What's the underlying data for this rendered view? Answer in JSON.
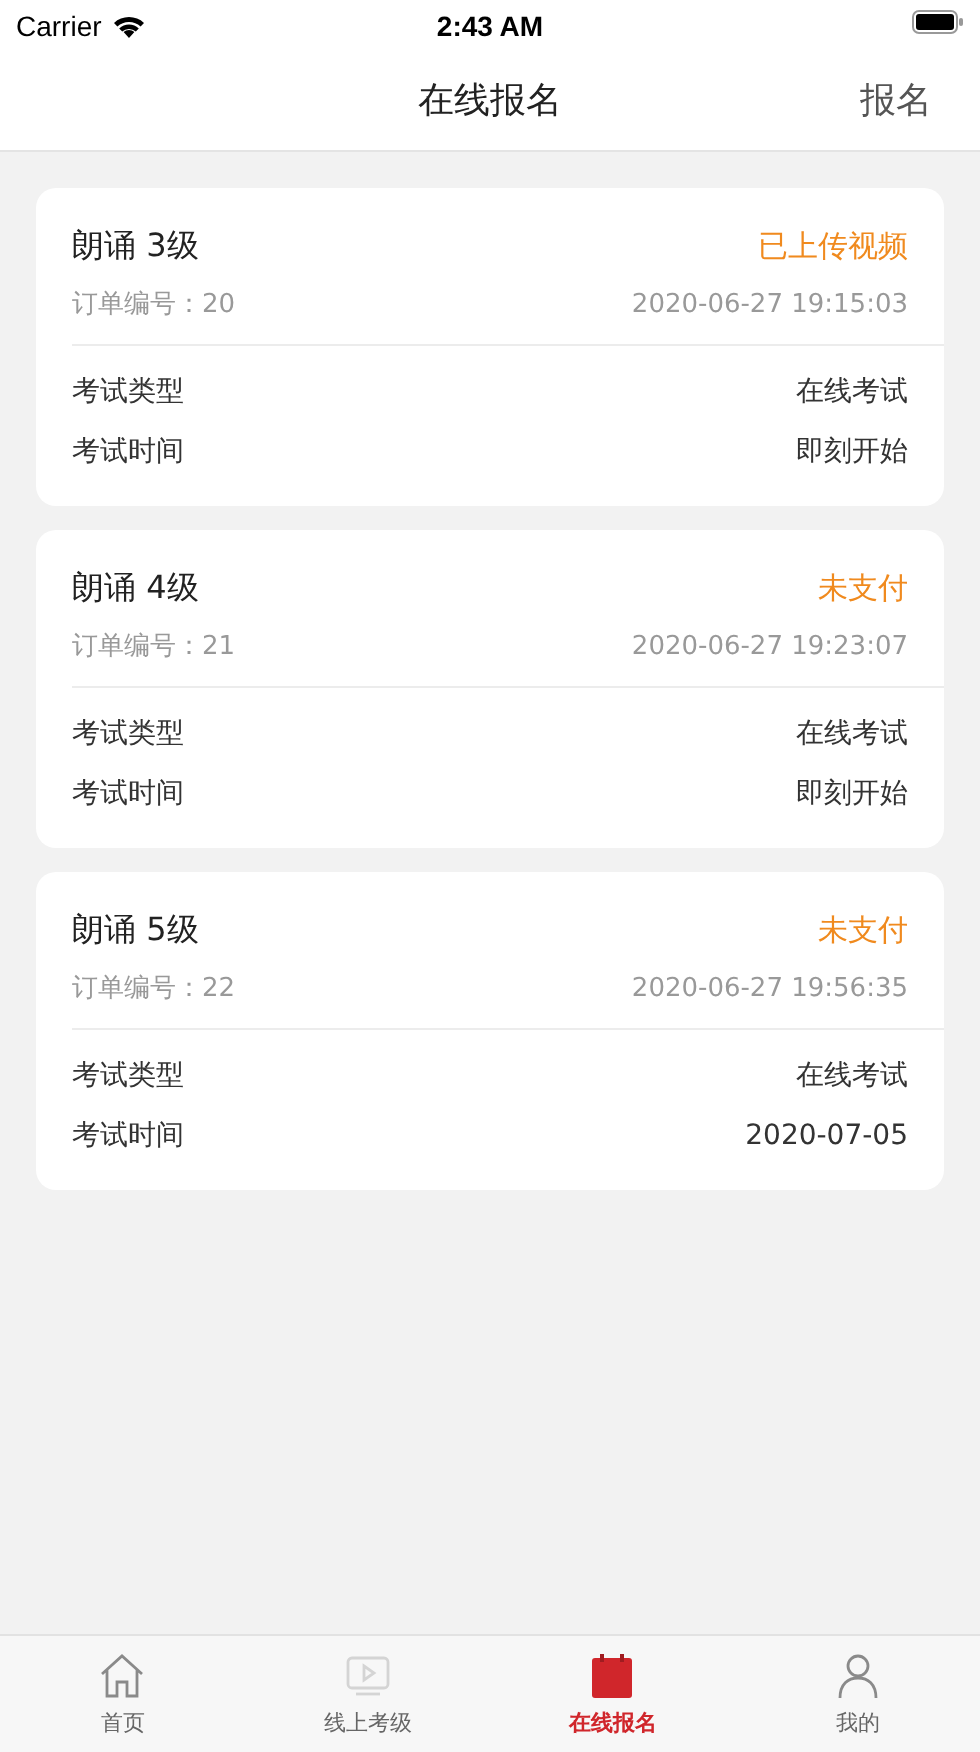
{
  "status_bar": {
    "carrier": "Carrier",
    "time": "2:43 AM"
  },
  "nav_bar": {
    "title": "在线报名",
    "action": "报名"
  },
  "orders": [
    {
      "title": "朗诵 3级",
      "status": "已上传视频",
      "order_label": "订单编号：20",
      "created": "2020-06-27 19:15:03",
      "fields": [
        {
          "label": "考试类型",
          "value": "在线考试"
        },
        {
          "label": "考试时间",
          "value": "即刻开始"
        }
      ]
    },
    {
      "title": "朗诵 4级",
      "status": "未支付",
      "order_label": "订单编号：21",
      "created": "2020-06-27 19:23:07",
      "fields": [
        {
          "label": "考试类型",
          "value": "在线考试"
        },
        {
          "label": "考试时间",
          "value": "即刻开始"
        }
      ]
    },
    {
      "title": "朗诵 5级",
      "status": "未支付",
      "order_label": "订单编号：22",
      "created": "2020-06-27 19:56:35",
      "fields": [
        {
          "label": "考试类型",
          "value": "在线考试"
        },
        {
          "label": "考试时间",
          "value": "2020-07-05"
        }
      ]
    }
  ],
  "tab_bar": [
    {
      "label": "首页",
      "kind": "home",
      "selected": false
    },
    {
      "label": "线上考级",
      "kind": "video",
      "selected": false
    },
    {
      "label": "在线报名",
      "kind": "calendar",
      "selected": true
    },
    {
      "label": "我的",
      "kind": "person",
      "selected": false
    }
  ]
}
